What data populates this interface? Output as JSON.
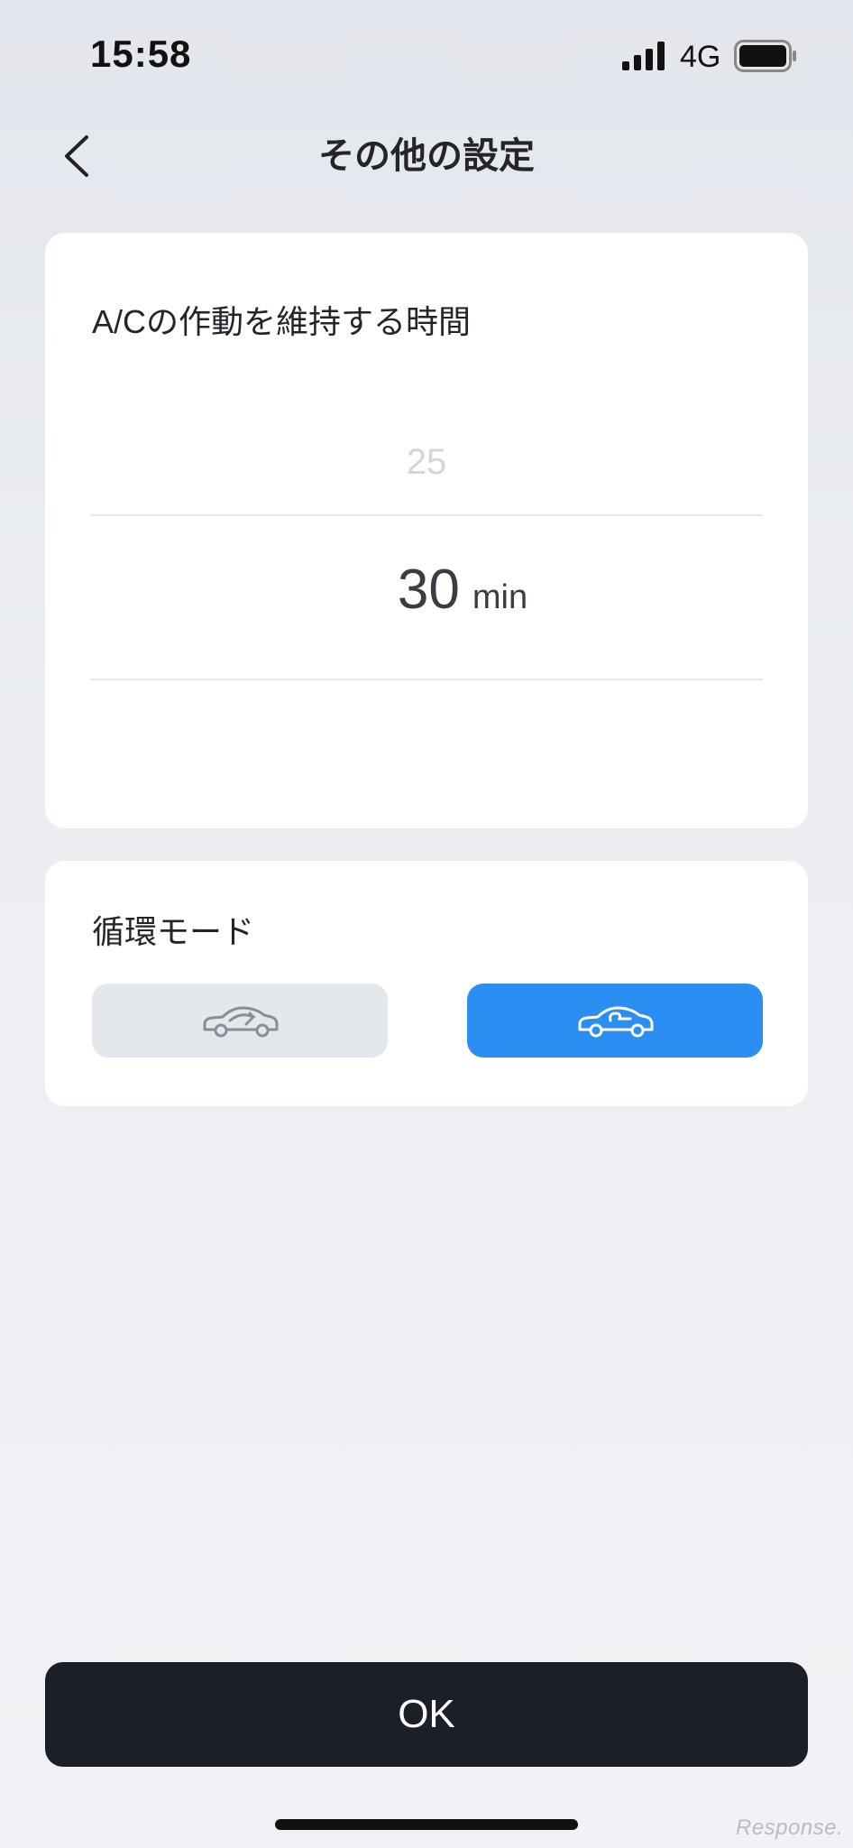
{
  "status_bar": {
    "time": "15:58",
    "network": "4G",
    "signal_icon": "signal-bars-icon",
    "battery_icon": "battery-icon"
  },
  "nav": {
    "back_icon": "chevron-left-icon",
    "title": "その他の設定"
  },
  "ac_duration": {
    "title": "A/Cの作動を維持する時間",
    "picker": {
      "previous_value": "25",
      "selected_value": "30",
      "unit": "min"
    }
  },
  "circulation_mode": {
    "title": "循環モード",
    "options": [
      {
        "icon": "car-recirculation-icon",
        "selected": false
      },
      {
        "icon": "car-fresh-air-icon",
        "selected": true
      }
    ]
  },
  "ok_button": {
    "label": "OK"
  },
  "watermark": {
    "text": "Response."
  },
  "colors": {
    "accent": "#2b8ef2",
    "button_dark": "#1c1f28",
    "option_inactive": "#e4e7ec"
  }
}
